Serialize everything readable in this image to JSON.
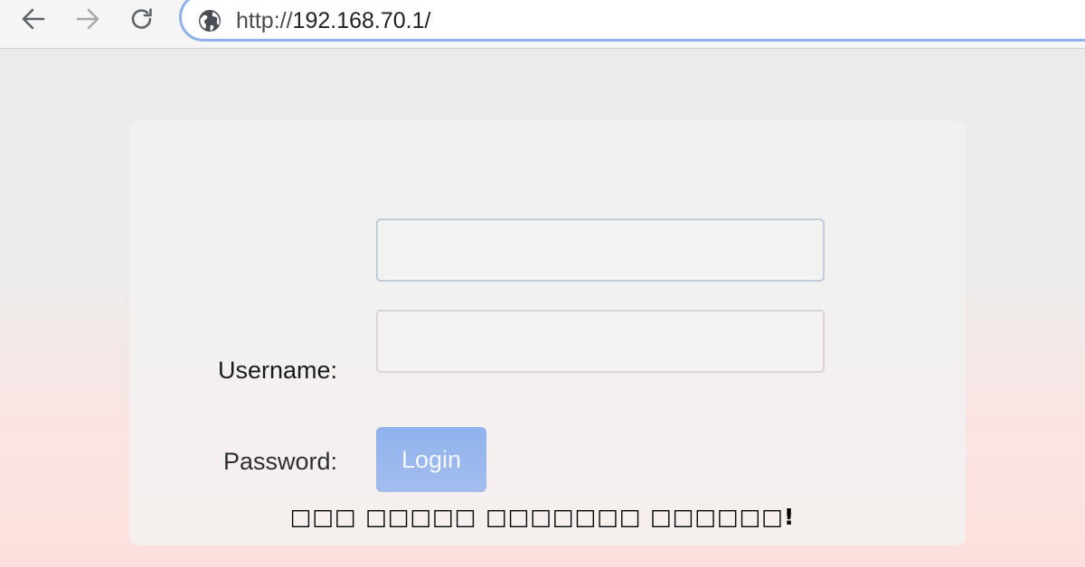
{
  "browser": {
    "url_prefix": "http://",
    "url_host": "192.168.70.1/",
    "accent_color": "#8fb0e8"
  },
  "form": {
    "username_label": "Username:",
    "password_label": "Password:",
    "username_value": "",
    "password_value": "",
    "login_label": "Login",
    "button_color": "#99b7ef"
  },
  "caption": {
    "text": "□□□ □□□□□ □□□□□□□ □□□□□□!"
  },
  "icons": {
    "back": "arrow-left-icon",
    "forward": "arrow-right-icon",
    "reload": "reload-icon",
    "site": "globe-icon"
  }
}
